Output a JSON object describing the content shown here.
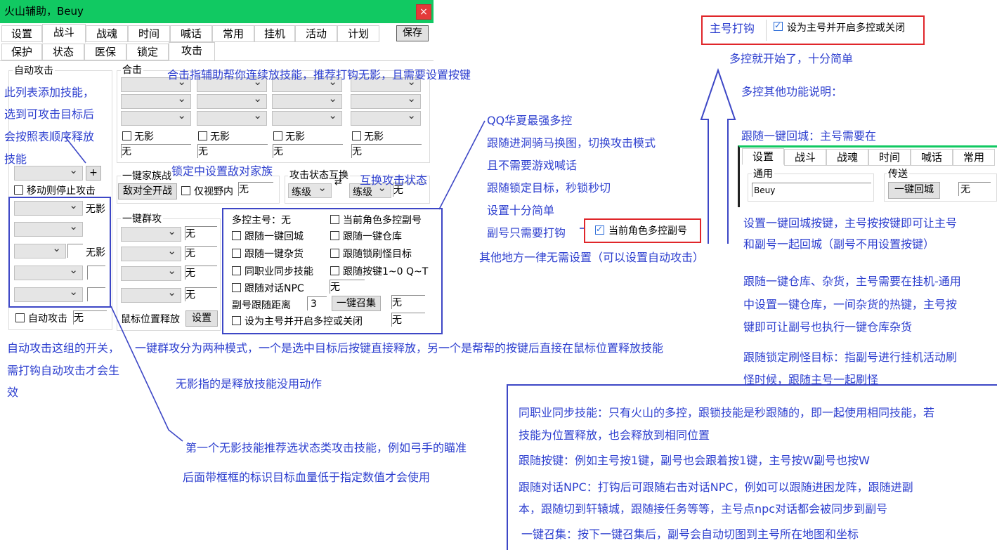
{
  "window": {
    "title": "火山辅助，Beuy",
    "close": "×"
  },
  "tabs_main": [
    "设置",
    "战斗",
    "战魂",
    "时间",
    "喊话",
    "常用",
    "挂机",
    "活动",
    "计划"
  ],
  "save_label": "保存",
  "tabs_sub": [
    "保护",
    "状态",
    "医保",
    "锁定",
    "攻击"
  ],
  "auto_attack": {
    "group_label": "自动攻击",
    "add_btn": "+",
    "move_stop": "移动则停止攻击",
    "wuying_1": "无影",
    "wuying_2": "无影",
    "toggle_label": "自动攻击",
    "toggle_value": "无"
  },
  "combo": {
    "group_label": "合击",
    "wuying": [
      "无影",
      "无影",
      "无影",
      "无影"
    ],
    "values": [
      "无",
      "无",
      "无",
      "无"
    ]
  },
  "family": {
    "group_label": "一键家族战",
    "btn": "敌对全开战",
    "only_wild": "仅视野内",
    "value": "无"
  },
  "attack_swap": {
    "group_label": "攻击状态互换",
    "left": "练级",
    "right": "练级",
    "value": "无"
  },
  "group_attack": {
    "group_label": "一键群攻",
    "values": [
      "无",
      "无",
      "无",
      "无"
    ],
    "mouse_label": "鼠标位置释放",
    "mouse_btn": "设置"
  },
  "multi": {
    "master": "多控主号：无",
    "current_char": "当前角色多控副号",
    "follow_return": "跟随一键回城",
    "follow_store": "跟随一键仓库",
    "follow_junk": "跟随一键杂货",
    "follow_lock": "跟随锁刷怪目标",
    "same_job": "同职业同步技能",
    "follow_keys": "跟随按键1~0 Q~T",
    "follow_npc": "跟随对话NPC",
    "npc_value": "无",
    "distance_label": "副号跟随距离",
    "distance_value": "3",
    "summon_btn": "一键召集",
    "summon_value": "无",
    "set_master": "设为主号并开启多控或关闭",
    "master_value": "无"
  },
  "notes": {
    "combo_hint": "合击指辅助帮你连续放技能，推荐打钩无影，且需要设置按键",
    "list_hint_1": "此列表添加技能，",
    "list_hint_2": "选到可攻击目标后",
    "list_hint_3": "会按照表顺序释放",
    "list_hint_4": "技能",
    "family_hint": "锁定中设置敌对家族",
    "swap_hint": "互换攻击状态",
    "qq_1": "QQ华夏最强多控",
    "qq_2": "跟随进洞骑马换图，切换攻击模式",
    "qq_3": "且不需要游戏喊话",
    "qq_4": "跟随锁定目标，秒锁秒切",
    "qq_5": "设置十分简单",
    "sub_only": "副号只需要打钩",
    "sub_chk": "当前角色多控副号",
    "other": "其他地方一律无需设置（可以设置自动攻击）",
    "auto_switch_1": "自动攻击这组的开关，",
    "auto_switch_2": "需打钩自动攻击才会生",
    "auto_switch_3": "效",
    "group_attack_hint": "一键群攻分为两种模式，一个是选中目标后按键直接释放，另一个是帮帮的按键后直接在鼠标位置释放技能",
    "wuying_hint": "无影指的是释放技能没用动作",
    "first_wuying": "第一个无影技能推荐选状态类攻击技能，例如弓手的瞄准",
    "boxed_hint": "后面带框框的标识目标血量低于指定数值才会使用",
    "master_chk_label": "主号打钩",
    "master_chk": "设为主号并开启多控或关闭",
    "start": "多控就开始了，十分简单",
    "more": "多控其他功能说明：",
    "follow_return_note": "跟随一键回城：主号需要在",
    "return_desc_1": "设置一键回城按键，主号按按键即可让主号",
    "return_desc_2": "和副号一起回城（副号不用设置按键）",
    "store_1": "跟随一键仓库、杂货，主号需要在挂机-通用",
    "store_2": "中设置一键仓库，一间杂货的热键，主号按",
    "store_3": "键即可让副号也执行一键仓库杂货",
    "lock_1": "跟随锁定刷怪目标：指副号进行挂机活动刷",
    "lock_2": "怪时候，跟随主号一起刷怪",
    "same_job_1": "同职业同步技能：只有火山的多控，跟锁技能是秒跟随的，即一起使用相同技能，若",
    "same_job_2": "技能为位置释放，也会释放到相同位置",
    "keys": "跟随按键：例如主号按1键，副号也会跟着按1键，主号按W副号也按W",
    "npc_1": "跟随对话NPC：打钩后可跟随右击对话NPC，例如可以跟随进困龙阵，跟随进副",
    "npc_2": "本，跟随切到轩辕城，跟随接任务等等，主号点npc对话都会被同步到副号",
    "summon": "一键召集：按下一键召集后，副号会自动切图到主号所在地图和坐标"
  },
  "inset": {
    "tabs": [
      "设置",
      "战斗",
      "战魂",
      "时间",
      "喊话",
      "常用"
    ],
    "group1": "通用",
    "field": "Beuy",
    "group2": "传送",
    "btn": "一键回城",
    "value": "无"
  },
  "colors": {
    "title_bar": "#11c962",
    "annotation": "#2d3fcf",
    "highlight_red": "#e0262a"
  }
}
